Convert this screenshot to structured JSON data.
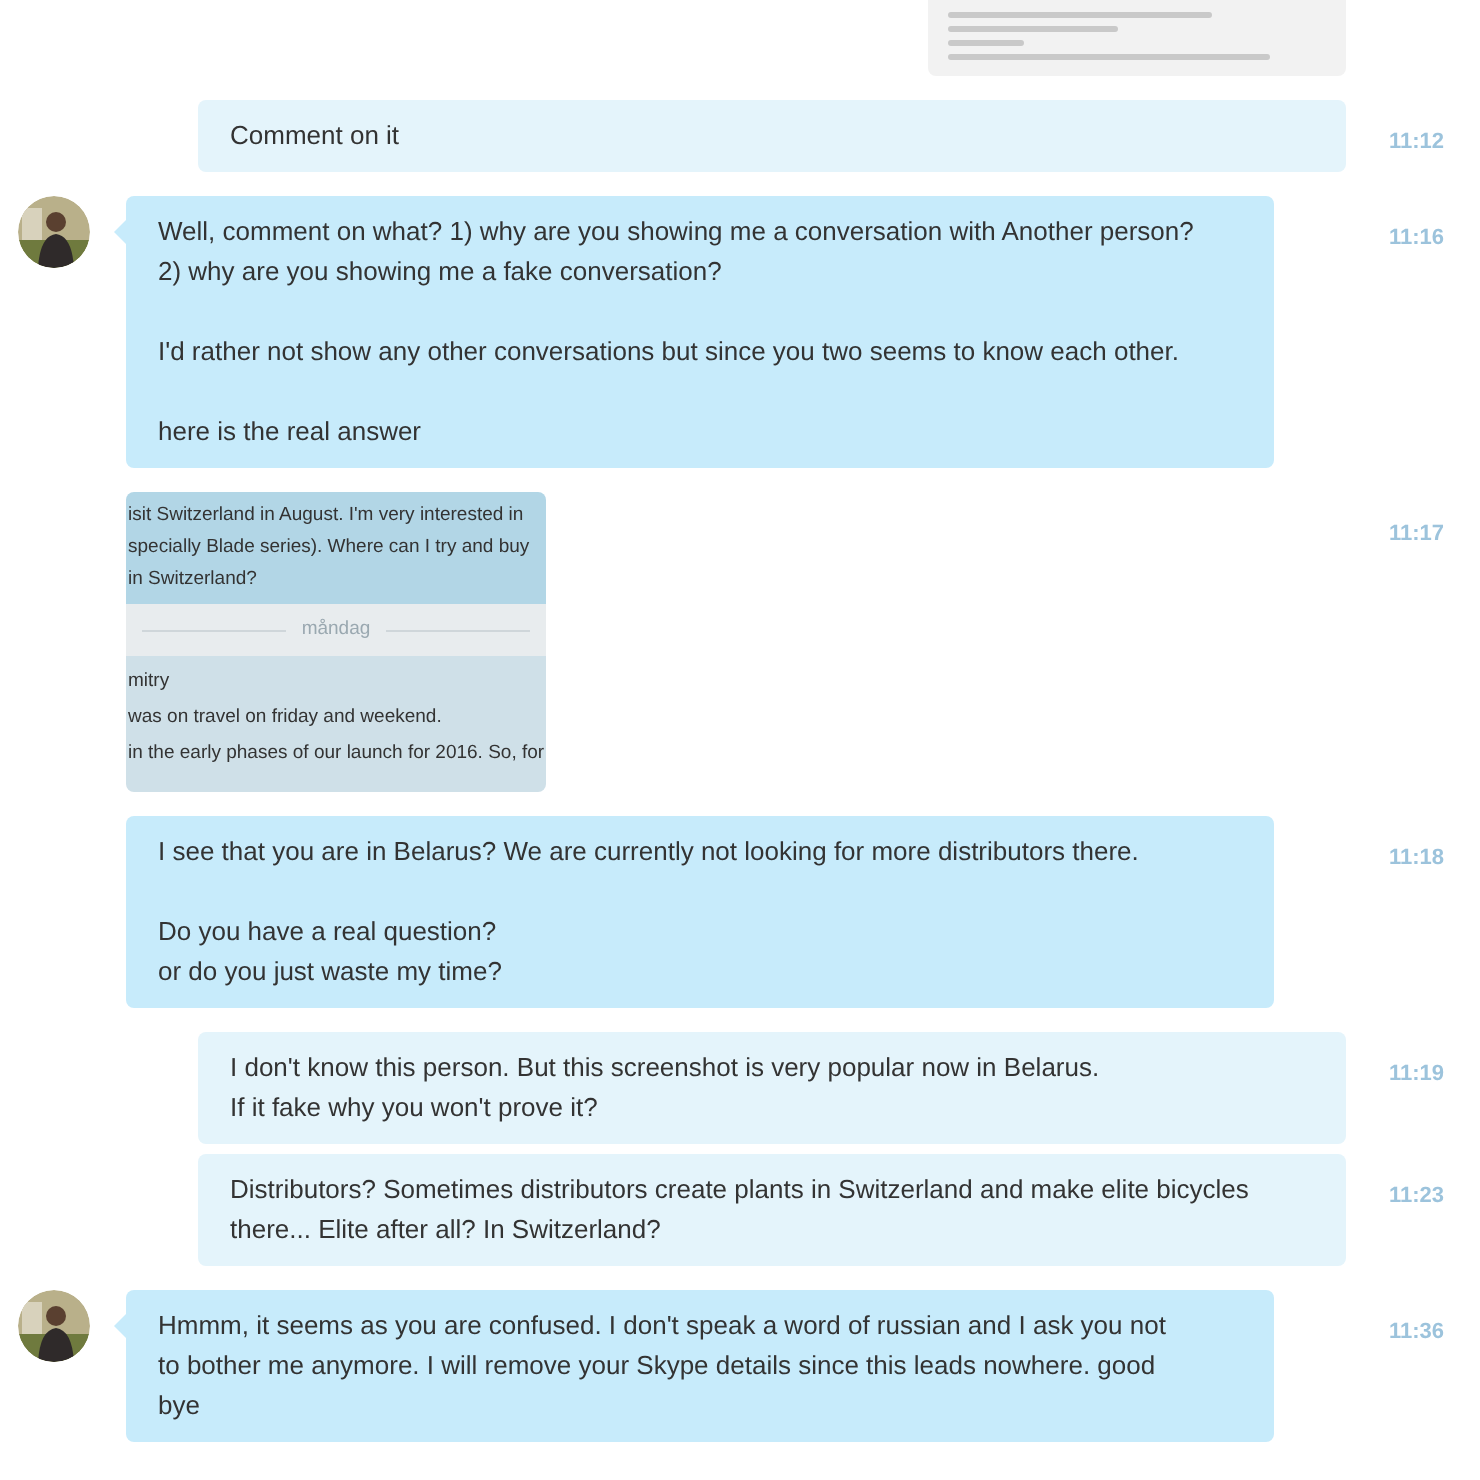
{
  "messages": [
    {
      "outgoing": true,
      "kind": "screenshot",
      "avatar": false
    },
    {
      "outgoing": true,
      "kind": "text",
      "avatar": false,
      "time": "11:12",
      "paragraphs": [
        [
          "Comment on it"
        ]
      ]
    },
    {
      "outgoing": false,
      "kind": "text",
      "avatar": true,
      "time": "11:16",
      "paragraphs": [
        [
          "Well, comment on what? 1) why are you showing me a conversation with Another person?",
          "2) why are you showing me a fake conversation?"
        ],
        [
          "I'd rather not show any other conversations but since you two seems to know each other."
        ],
        [
          "here is the real answer"
        ]
      ]
    },
    {
      "outgoing": false,
      "kind": "image",
      "avatar": false,
      "time": "11:17",
      "image": {
        "top_lines": [
          "isit Switzerland in August. I'm very interested in",
          "specially Blade series). Where can I try and buy",
          "in Switzerland?"
        ],
        "day": "måndag",
        "bottom_lines": [
          "mitry",
          "was on travel on friday and weekend.",
          "in the early phases of our launch for 2016. So, for"
        ]
      }
    },
    {
      "outgoing": false,
      "kind": "text",
      "avatar": false,
      "time": "11:18",
      "paragraphs": [
        [
          "I see that you are in Belarus? We are currently not looking for more distributors there."
        ],
        [
          "Do you have a real question?",
          "or do you just waste my time?"
        ]
      ]
    },
    {
      "outgoing": true,
      "kind": "text",
      "avatar": false,
      "time": "11:19",
      "paragraphs": [
        [
          "I don't know this person. But this screenshot is very popular now in Belarus.",
          "If it fake why you won't prove it?"
        ]
      ]
    },
    {
      "outgoing": true,
      "kind": "text",
      "avatar": false,
      "time": "11:23",
      "paragraphs": [
        [
          "Distributors? Sometimes distributors create plants in Switzerland and make elite bicycles",
          "there... Elite after all? In Switzerland?"
        ]
      ]
    },
    {
      "outgoing": false,
      "kind": "text",
      "avatar": true,
      "time": "11:36",
      "paragraphs": [
        [
          "Hmmm, it seems as you are confused. I don't speak a word of russian and I ask you not",
          "to bother me anymore. I will remove your Skype details since this leads nowhere. good",
          "bye"
        ]
      ]
    }
  ]
}
